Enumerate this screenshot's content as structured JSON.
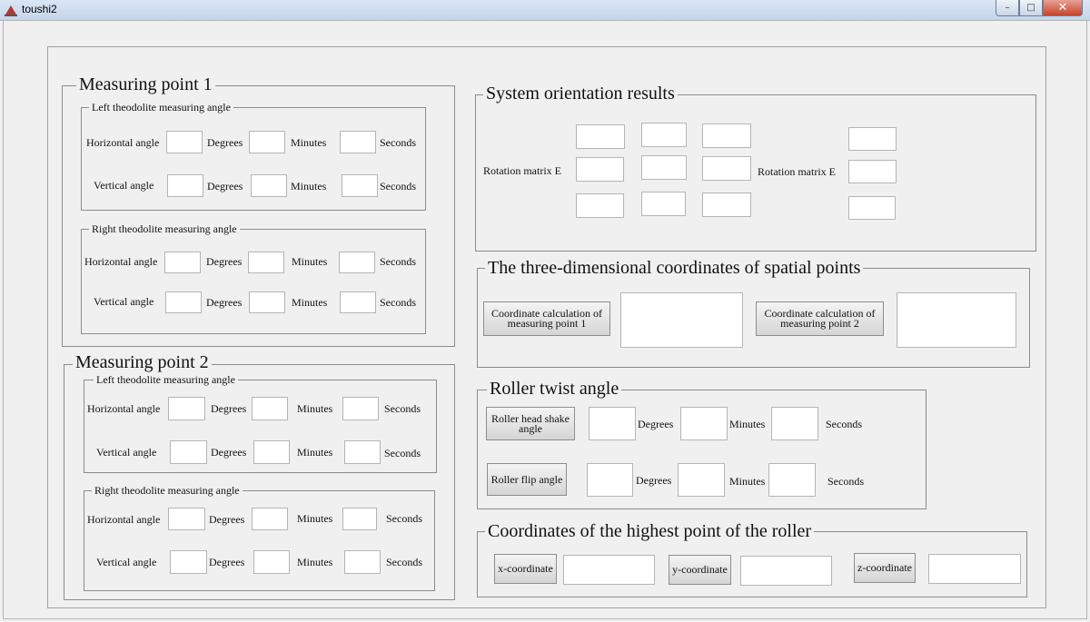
{
  "window": {
    "title": "toushi2",
    "min_label": "–",
    "max_label": "□",
    "close_label": "✕"
  },
  "labels": {
    "horizontal_angle": "Horizontal angle",
    "vertical_angle": "Vertical angle",
    "degrees": "Degrees",
    "minutes": "Minutes",
    "seconds": "Seconds",
    "left_theodolite": "Left theodolite measuring angle",
    "right_theodolite": "Right theodolite measuring angle"
  },
  "measuring_point_1": {
    "title": "Measuring point 1"
  },
  "measuring_point_2": {
    "title": "Measuring point 2"
  },
  "system_orientation": {
    "title": "System orientation results",
    "rotation_matrix_label": "Rotation matrix E",
    "rotation_matrix_label_2": "Rotation matrix E"
  },
  "spatial_points": {
    "title": "The three-dimensional coordinates of spatial points",
    "btn_point1": "Coordinate calculation of measuring point 1",
    "btn_point2": "Coordinate calculation of measuring point 2"
  },
  "roller_twist": {
    "title": "Roller twist angle",
    "btn_head_shake": "Roller head shake angle",
    "btn_flip": "Roller flip angle"
  },
  "highest_point": {
    "title": "Coordinates of the highest point of the roller",
    "btn_x": "x-coordinate",
    "btn_y": "y-coordinate",
    "btn_z": "z-coordinate"
  }
}
